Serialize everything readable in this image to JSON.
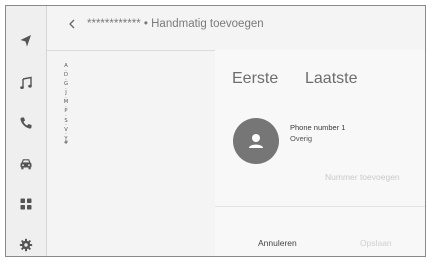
{
  "header": {
    "title": "************ • Handmatig toevoegen"
  },
  "sidebar": {
    "items": [
      {
        "icon": "navigation-arrow-icon"
      },
      {
        "icon": "music-note-icon"
      },
      {
        "icon": "phone-icon"
      },
      {
        "icon": "car-icon"
      },
      {
        "icon": "apps-grid-icon"
      },
      {
        "icon": "settings-gear-icon"
      }
    ]
  },
  "alphabet_index": [
    "A",
    "·",
    "D",
    "·",
    "G",
    "·",
    "J",
    "·",
    "M",
    "·",
    "P",
    "·",
    "S",
    "·",
    "V",
    "·",
    "Y",
    "#"
  ],
  "contact": {
    "first_name_placeholder": "Eerste",
    "last_name_placeholder": "Laatste",
    "phone_label": "Phone number 1",
    "phone_type": "Overig",
    "add_number": "Nummer toevoegen"
  },
  "footer": {
    "cancel_label": "Annuleren",
    "save_label": "Opslaan"
  },
  "colors": {
    "accent_avatar": "#767676",
    "disabled_text": "#cfcfcf"
  }
}
